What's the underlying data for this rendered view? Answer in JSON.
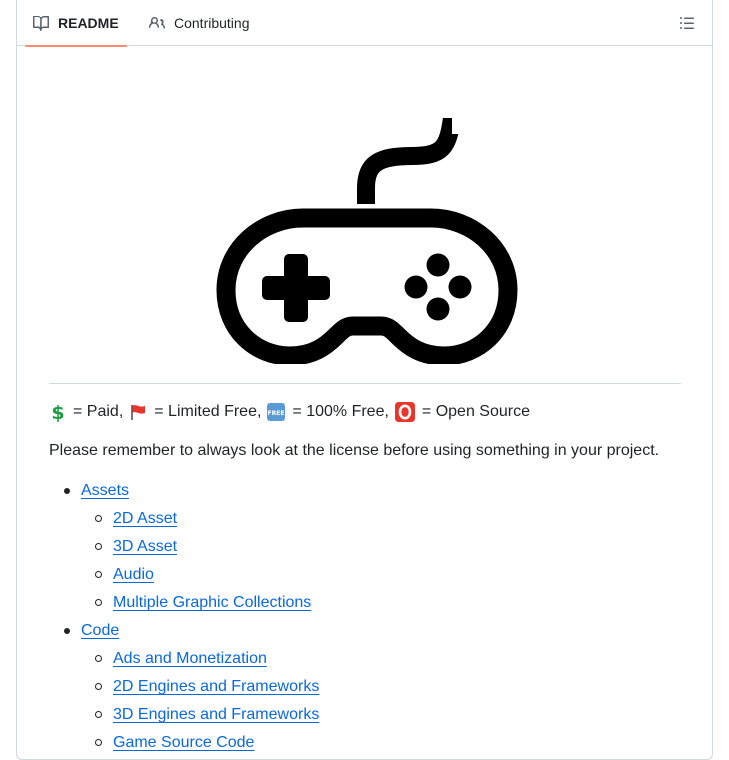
{
  "tabs": {
    "readme_label": "README",
    "contributing_label": "Contributing"
  },
  "icons": {
    "readme": "book-icon",
    "contributing": "people-icon",
    "outline": "list-unordered-icon",
    "logo": "gamepad-icon"
  },
  "legend": {
    "paid_emoji": "💲",
    "paid_label": "= Paid,",
    "limited_emoji": "🚩",
    "limited_label": "= Limited Free,",
    "free_emoji": "🆓",
    "free_label": "= 100% Free,",
    "open_emoji": "🅾️",
    "open_label": "= Open Source"
  },
  "note": "Please remember to always look at the license before using something in your project.",
  "toc": [
    {
      "label": "Assets",
      "children": [
        "2D Asset",
        "3D Asset",
        "Audio",
        "Multiple Graphic Collections"
      ]
    },
    {
      "label": "Code",
      "children": [
        "Ads and Monetization",
        "2D Engines and Frameworks",
        "3D Engines and Frameworks",
        "Game Source Code"
      ]
    }
  ],
  "colors": {
    "link": "#0969da",
    "tab_underline": "#fd8c73",
    "paid": "#1a9d3f",
    "flag": "#e8362d",
    "free_badge": "#5b9bd5",
    "open_badge": "#e8362d"
  }
}
